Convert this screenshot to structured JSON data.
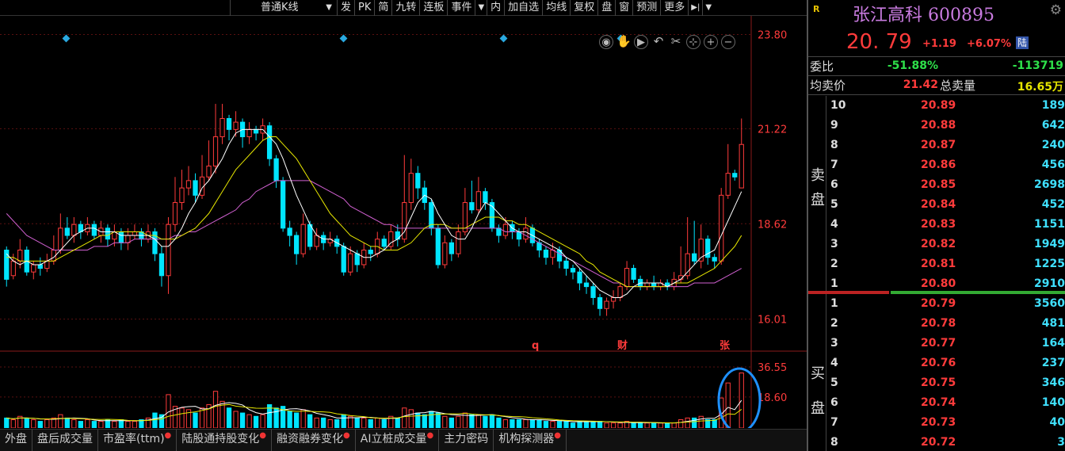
{
  "toolbar": {
    "kline_type": "普通K线",
    "items": [
      "发",
      "PK",
      "简",
      "九转",
      "连板",
      "事件"
    ],
    "items2": [
      "内",
      "加自选",
      "均线",
      "复权",
      "盘",
      "窗",
      "预测",
      "更多"
    ],
    "end_icon": "exit-icon"
  },
  "chart_tools": [
    "eye-icon",
    "hand-icon",
    "play-icon",
    "undo-icon",
    "scissors-icon",
    "crosshair-icon",
    "zoom-in-icon",
    "zoom-out-icon"
  ],
  "price_axis": {
    "labels": [
      "23.80",
      "21.22",
      "18.62",
      "16.01"
    ],
    "values": [
      23.8,
      21.22,
      18.62,
      16.01
    ]
  },
  "volume_axis": {
    "labels": [
      "36.55",
      "18.60"
    ],
    "values": [
      36.55,
      18.6
    ]
  },
  "event_markers": [
    "q",
    "财",
    "张"
  ],
  "colors": {
    "up": "#ff3b3b",
    "down": "#00e5ff",
    "ma5": "#ffffff",
    "ma10": "#e6e600",
    "ma20": "#d060d0",
    "diamond": "#2aa9e0",
    "highlight": "#1e90ff"
  },
  "chart_data": {
    "type": "candlestick",
    "y_range": [
      15.2,
      24.2
    ],
    "volume_range": [
      0,
      38
    ],
    "candles": [
      [
        17.9,
        17.1,
        18.0,
        16.9,
        6
      ],
      [
        17.2,
        17.6,
        17.8,
        17.1,
        5
      ],
      [
        17.6,
        17.9,
        18.2,
        17.4,
        7
      ],
      [
        17.9,
        17.3,
        18.0,
        17.2,
        6
      ],
      [
        17.3,
        17.5,
        17.6,
        17.1,
        5
      ],
      [
        17.5,
        17.4,
        17.7,
        17.2,
        4
      ],
      [
        17.4,
        17.6,
        17.8,
        17.3,
        5
      ],
      [
        17.6,
        17.9,
        18.3,
        17.5,
        6
      ],
      [
        17.9,
        18.5,
        18.9,
        17.8,
        8
      ],
      [
        18.5,
        18.3,
        18.8,
        18.2,
        6
      ],
      [
        18.3,
        18.6,
        18.8,
        18.1,
        5
      ],
      [
        18.6,
        18.4,
        18.7,
        18.2,
        4
      ],
      [
        18.4,
        18.6,
        18.8,
        18.3,
        5
      ],
      [
        18.6,
        18.3,
        18.7,
        18.2,
        4
      ],
      [
        18.3,
        18.5,
        18.7,
        18.1,
        4
      ],
      [
        18.5,
        18.2,
        18.6,
        18.0,
        5
      ],
      [
        18.2,
        18.4,
        18.6,
        18.0,
        4
      ],
      [
        18.4,
        18.1,
        18.5,
        17.9,
        5
      ],
      [
        18.1,
        18.3,
        18.5,
        17.9,
        4
      ],
      [
        18.3,
        18.4,
        18.6,
        18.2,
        4
      ],
      [
        18.4,
        18.2,
        18.5,
        18.0,
        5
      ],
      [
        18.2,
        18.4,
        18.6,
        18.1,
        6
      ],
      [
        18.4,
        17.8,
        18.5,
        17.6,
        9
      ],
      [
        17.8,
        17.2,
        18.0,
        16.9,
        8
      ],
      [
        17.2,
        18.6,
        18.8,
        16.7,
        20
      ],
      [
        18.6,
        19.2,
        19.9,
        18.4,
        13
      ],
      [
        19.2,
        19.6,
        20.1,
        19.0,
        12
      ],
      [
        19.6,
        19.8,
        20.2,
        19.4,
        11
      ],
      [
        19.8,
        19.4,
        20.0,
        19.2,
        9
      ],
      [
        19.4,
        19.9,
        20.5,
        19.3,
        12
      ],
      [
        19.9,
        20.2,
        20.9,
        19.8,
        14
      ],
      [
        20.2,
        21.0,
        21.9,
        20.0,
        22
      ],
      [
        21.0,
        21.5,
        21.9,
        20.8,
        16
      ],
      [
        21.5,
        21.2,
        21.6,
        20.9,
        12
      ],
      [
        21.2,
        21.4,
        21.7,
        21.0,
        10
      ],
      [
        21.4,
        21.0,
        21.5,
        20.7,
        9
      ],
      [
        21.0,
        21.2,
        21.4,
        20.8,
        8
      ],
      [
        21.2,
        21.1,
        21.3,
        20.9,
        7
      ],
      [
        21.1,
        21.3,
        21.5,
        20.9,
        8
      ],
      [
        21.3,
        20.4,
        21.4,
        20.2,
        14
      ],
      [
        20.4,
        19.8,
        20.5,
        19.6,
        12
      ],
      [
        19.8,
        18.5,
        19.9,
        18.4,
        13
      ],
      [
        18.5,
        18.3,
        18.7,
        18.0,
        10
      ],
      [
        18.3,
        17.8,
        18.4,
        17.5,
        9
      ],
      [
        17.8,
        18.6,
        18.9,
        17.7,
        11
      ],
      [
        18.6,
        18.0,
        18.7,
        17.9,
        8
      ],
      [
        18.0,
        18.3,
        18.5,
        17.9,
        6
      ],
      [
        18.3,
        18.1,
        18.4,
        17.9,
        6
      ],
      [
        18.1,
        18.2,
        18.4,
        18.0,
        5
      ],
      [
        18.2,
        18.0,
        18.3,
        17.8,
        5
      ],
      [
        18.0,
        17.3,
        18.1,
        17.2,
        8
      ],
      [
        17.3,
        17.8,
        18.0,
        17.2,
        7
      ],
      [
        17.8,
        17.5,
        17.9,
        17.3,
        6
      ],
      [
        17.5,
        17.9,
        18.1,
        17.4,
        6
      ],
      [
        17.9,
        17.8,
        18.0,
        17.6,
        5
      ],
      [
        17.8,
        18.2,
        18.4,
        17.7,
        6
      ],
      [
        18.2,
        18.0,
        18.3,
        17.9,
        5
      ],
      [
        18.0,
        18.4,
        18.6,
        17.9,
        7
      ],
      [
        18.4,
        18.2,
        18.6,
        18.0,
        6
      ],
      [
        18.2,
        19.2,
        20.5,
        18.1,
        12
      ],
      [
        19.2,
        20.0,
        20.4,
        19.0,
        11
      ],
      [
        20.0,
        19.6,
        20.2,
        19.3,
        9
      ],
      [
        19.6,
        19.2,
        19.8,
        19.0,
        8
      ],
      [
        19.2,
        18.5,
        19.3,
        18.3,
        10
      ],
      [
        18.5,
        17.5,
        18.6,
        17.4,
        9
      ],
      [
        17.5,
        18.1,
        18.3,
        17.4,
        7
      ],
      [
        18.1,
        17.8,
        18.2,
        17.6,
        6
      ],
      [
        17.8,
        18.4,
        18.6,
        17.7,
        7
      ],
      [
        18.4,
        19.2,
        19.6,
        18.3,
        9
      ],
      [
        19.2,
        19.0,
        19.8,
        18.9,
        8
      ],
      [
        19.0,
        19.5,
        19.9,
        18.9,
        8
      ],
      [
        19.5,
        19.2,
        19.6,
        19.0,
        7
      ],
      [
        19.2,
        18.5,
        19.3,
        18.4,
        8
      ],
      [
        18.5,
        18.3,
        18.6,
        18.1,
        6
      ],
      [
        18.3,
        18.6,
        18.8,
        18.2,
        5
      ],
      [
        18.6,
        18.4,
        18.7,
        18.2,
        5
      ],
      [
        18.4,
        18.2,
        18.5,
        18.0,
        5
      ],
      [
        18.2,
        18.5,
        18.8,
        18.1,
        5
      ],
      [
        18.5,
        18.1,
        18.6,
        18.0,
        5
      ],
      [
        18.1,
        17.9,
        18.2,
        17.7,
        5
      ],
      [
        17.9,
        17.7,
        18.0,
        17.5,
        4
      ],
      [
        17.7,
        17.9,
        18.1,
        17.5,
        4
      ],
      [
        17.9,
        17.6,
        18.0,
        17.4,
        4
      ],
      [
        17.6,
        17.4,
        17.7,
        17.2,
        4
      ],
      [
        17.4,
        17.3,
        17.5,
        17.1,
        3
      ],
      [
        17.3,
        17.0,
        17.4,
        16.8,
        4
      ],
      [
        17.0,
        16.9,
        17.2,
        16.7,
        4
      ],
      [
        16.9,
        16.6,
        17.0,
        16.4,
        4
      ],
      [
        16.6,
        16.3,
        16.7,
        16.1,
        4
      ],
      [
        16.3,
        16.5,
        16.6,
        16.1,
        3
      ],
      [
        16.5,
        16.6,
        16.8,
        16.3,
        3
      ],
      [
        16.6,
        16.9,
        17.0,
        16.5,
        3
      ],
      [
        16.9,
        17.4,
        17.6,
        16.8,
        4
      ],
      [
        17.4,
        17.1,
        17.5,
        17.0,
        3
      ],
      [
        17.1,
        16.9,
        17.2,
        16.8,
        3
      ],
      [
        16.9,
        17.0,
        17.1,
        16.8,
        3
      ],
      [
        17.0,
        16.9,
        17.2,
        16.8,
        3
      ],
      [
        16.9,
        17.0,
        17.1,
        16.8,
        3
      ],
      [
        17.0,
        16.9,
        17.1,
        16.8,
        3
      ],
      [
        16.9,
        17.1,
        17.3,
        16.8,
        3
      ],
      [
        17.1,
        17.2,
        18.0,
        17.0,
        5
      ],
      [
        17.2,
        17.8,
        18.8,
        17.1,
        6
      ],
      [
        17.8,
        17.6,
        18.7,
        17.5,
        6
      ],
      [
        17.6,
        18.2,
        18.6,
        17.4,
        7
      ],
      [
        18.2,
        17.7,
        18.3,
        17.5,
        5
      ],
      [
        17.7,
        17.6,
        17.8,
        17.4,
        5
      ],
      [
        17.6,
        19.4,
        19.6,
        17.5,
        18
      ],
      [
        19.4,
        20.0,
        20.8,
        19.3,
        27
      ],
      [
        20.0,
        19.9,
        20.1,
        19.8,
        0
      ],
      [
        19.6,
        20.79,
        21.5,
        19.6,
        33
      ]
    ],
    "ma5": [
      17.8,
      17.6,
      17.5,
      17.6,
      17.5,
      17.5,
      17.6,
      17.7,
      17.9,
      18.1,
      18.3,
      18.4,
      18.5,
      18.5,
      18.4,
      18.4,
      18.4,
      18.3,
      18.3,
      18.3,
      18.3,
      18.3,
      18.2,
      18.0,
      18.0,
      18.2,
      18.5,
      18.9,
      19.2,
      19.6,
      19.8,
      20.1,
      20.4,
      20.8,
      21.1,
      21.2,
      21.2,
      21.2,
      21.2,
      21.0,
      20.8,
      20.4,
      19.9,
      19.4,
      19.0,
      18.6,
      18.3,
      18.2,
      18.2,
      18.1,
      18.0,
      17.9,
      17.8,
      17.7,
      17.7,
      17.8,
      17.9,
      18.1,
      18.2,
      18.4,
      18.8,
      19.2,
      19.4,
      19.3,
      18.9,
      18.6,
      18.3,
      18.2,
      18.2,
      18.5,
      18.9,
      19.2,
      19.1,
      18.9,
      18.7,
      18.5,
      18.4,
      18.4,
      18.3,
      18.2,
      18.1,
      18.0,
      17.9,
      17.7,
      17.6,
      17.4,
      17.2,
      17.0,
      16.8,
      16.7,
      16.6,
      16.6,
      16.7,
      16.9,
      17.0,
      17.0,
      17.0,
      17.0,
      16.9,
      17.0,
      17.1,
      17.3,
      17.5,
      17.7,
      17.8,
      17.9,
      18.3,
      18.7,
      19.1,
      19.5
    ],
    "ma10": [
      17.7,
      17.7,
      17.6,
      17.6,
      17.6,
      17.6,
      17.6,
      17.6,
      17.7,
      17.8,
      17.9,
      18.0,
      18.1,
      18.2,
      18.3,
      18.3,
      18.4,
      18.4,
      18.4,
      18.4,
      18.4,
      18.3,
      18.3,
      18.2,
      18.2,
      18.2,
      18.3,
      18.4,
      18.5,
      18.7,
      18.9,
      19.2,
      19.5,
      19.8,
      20.1,
      20.3,
      20.5,
      20.7,
      20.9,
      21.0,
      21.0,
      20.8,
      20.6,
      20.4,
      20.1,
      19.8,
      19.5,
      19.2,
      18.9,
      18.7,
      18.5,
      18.3,
      18.2,
      18.1,
      18.0,
      18.0,
      17.9,
      17.9,
      17.9,
      18.0,
      18.1,
      18.3,
      18.5,
      18.6,
      18.6,
      18.6,
      18.5,
      18.5,
      18.5,
      18.6,
      18.7,
      18.8,
      18.8,
      18.8,
      18.7,
      18.7,
      18.6,
      18.6,
      18.5,
      18.4,
      18.3,
      18.2,
      18.1,
      18.0,
      17.9,
      17.8,
      17.6,
      17.5,
      17.3,
      17.2,
      17.1,
      17.0,
      16.9,
      16.9,
      16.9,
      16.9,
      16.9,
      16.9,
      16.9,
      17.0,
      17.0,
      17.0,
      17.1,
      17.2,
      17.3,
      17.4,
      17.6,
      17.8,
      18.0,
      18.3
    ],
    "ma20": [
      18.9,
      18.7,
      18.5,
      18.3,
      18.2,
      18.1,
      18.0,
      17.9,
      17.9,
      17.9,
      17.9,
      17.9,
      17.9,
      18.0,
      18.0,
      18.0,
      18.1,
      18.1,
      18.1,
      18.2,
      18.2,
      18.2,
      18.2,
      18.2,
      18.2,
      18.3,
      18.3,
      18.4,
      18.4,
      18.5,
      18.6,
      18.7,
      18.8,
      18.9,
      19.0,
      19.2,
      19.3,
      19.5,
      19.6,
      19.7,
      19.8,
      19.8,
      19.8,
      19.8,
      19.8,
      19.8,
      19.7,
      19.6,
      19.5,
      19.4,
      19.3,
      19.1,
      19.0,
      18.9,
      18.8,
      18.7,
      18.6,
      18.6,
      18.5,
      18.5,
      18.5,
      18.5,
      18.5,
      18.5,
      18.5,
      18.5,
      18.5,
      18.5,
      18.5,
      18.5,
      18.5,
      18.5,
      18.5,
      18.5,
      18.4,
      18.4,
      18.4,
      18.3,
      18.2,
      18.1,
      18.0,
      17.9,
      17.8,
      17.7,
      17.6,
      17.5,
      17.4,
      17.3,
      17.2,
      17.1,
      17.0,
      17.0,
      16.9,
      16.9,
      16.9,
      16.9,
      16.9,
      16.9,
      16.9,
      16.9,
      16.9,
      16.9,
      17.0,
      17.0,
      17.0,
      17.0,
      17.1,
      17.2,
      17.3,
      17.4
    ]
  },
  "panel": {
    "badge": "R",
    "name": "张江高科 600895",
    "price": "20. 79",
    "change": "+1.19",
    "change_pct": "+6.07%",
    "lu_tag": "陆",
    "weibi_label": "委比",
    "weibi_pct": "-51.88%",
    "weibi_num": "-113719",
    "avg_sell_label": "均卖价",
    "avg_sell": "21.42",
    "total_sell_label": "总卖量",
    "total_sell": "16.65万",
    "sell_label": [
      "卖",
      "盘"
    ],
    "buy_label": [
      "买",
      "盘"
    ],
    "sell": [
      {
        "n": "10",
        "p": "20.89",
        "q": "189"
      },
      {
        "n": "9",
        "p": "20.88",
        "q": "642"
      },
      {
        "n": "8",
        "p": "20.87",
        "q": "240"
      },
      {
        "n": "7",
        "p": "20.86",
        "q": "456"
      },
      {
        "n": "6",
        "p": "20.85",
        "q": "2698"
      },
      {
        "n": "5",
        "p": "20.84",
        "q": "452"
      },
      {
        "n": "4",
        "p": "20.83",
        "q": "1151"
      },
      {
        "n": "3",
        "p": "20.82",
        "q": "1949"
      },
      {
        "n": "2",
        "p": "20.81",
        "q": "1225"
      },
      {
        "n": "1",
        "p": "20.80",
        "q": "2910"
      }
    ],
    "buy": [
      {
        "n": "1",
        "p": "20.79",
        "q": "3560"
      },
      {
        "n": "2",
        "p": "20.78",
        "q": "481"
      },
      {
        "n": "3",
        "p": "20.77",
        "q": "164"
      },
      {
        "n": "4",
        "p": "20.76",
        "q": "237"
      },
      {
        "n": "5",
        "p": "20.75",
        "q": "346"
      },
      {
        "n": "6",
        "p": "20.74",
        "q": "140"
      },
      {
        "n": "7",
        "p": "20.73",
        "q": "40"
      },
      {
        "n": "8",
        "p": "20.72",
        "q": "3"
      }
    ]
  },
  "bottom_tabs": [
    "外盘",
    "盘后成交量",
    "市盈率(ttm)",
    "陆股通持股变化",
    "融资融券变化",
    "AI立桩成交量",
    "主力密码",
    "机构探测器"
  ],
  "bottom_tabs_dot": [
    false,
    false,
    true,
    true,
    true,
    true,
    false,
    true
  ]
}
